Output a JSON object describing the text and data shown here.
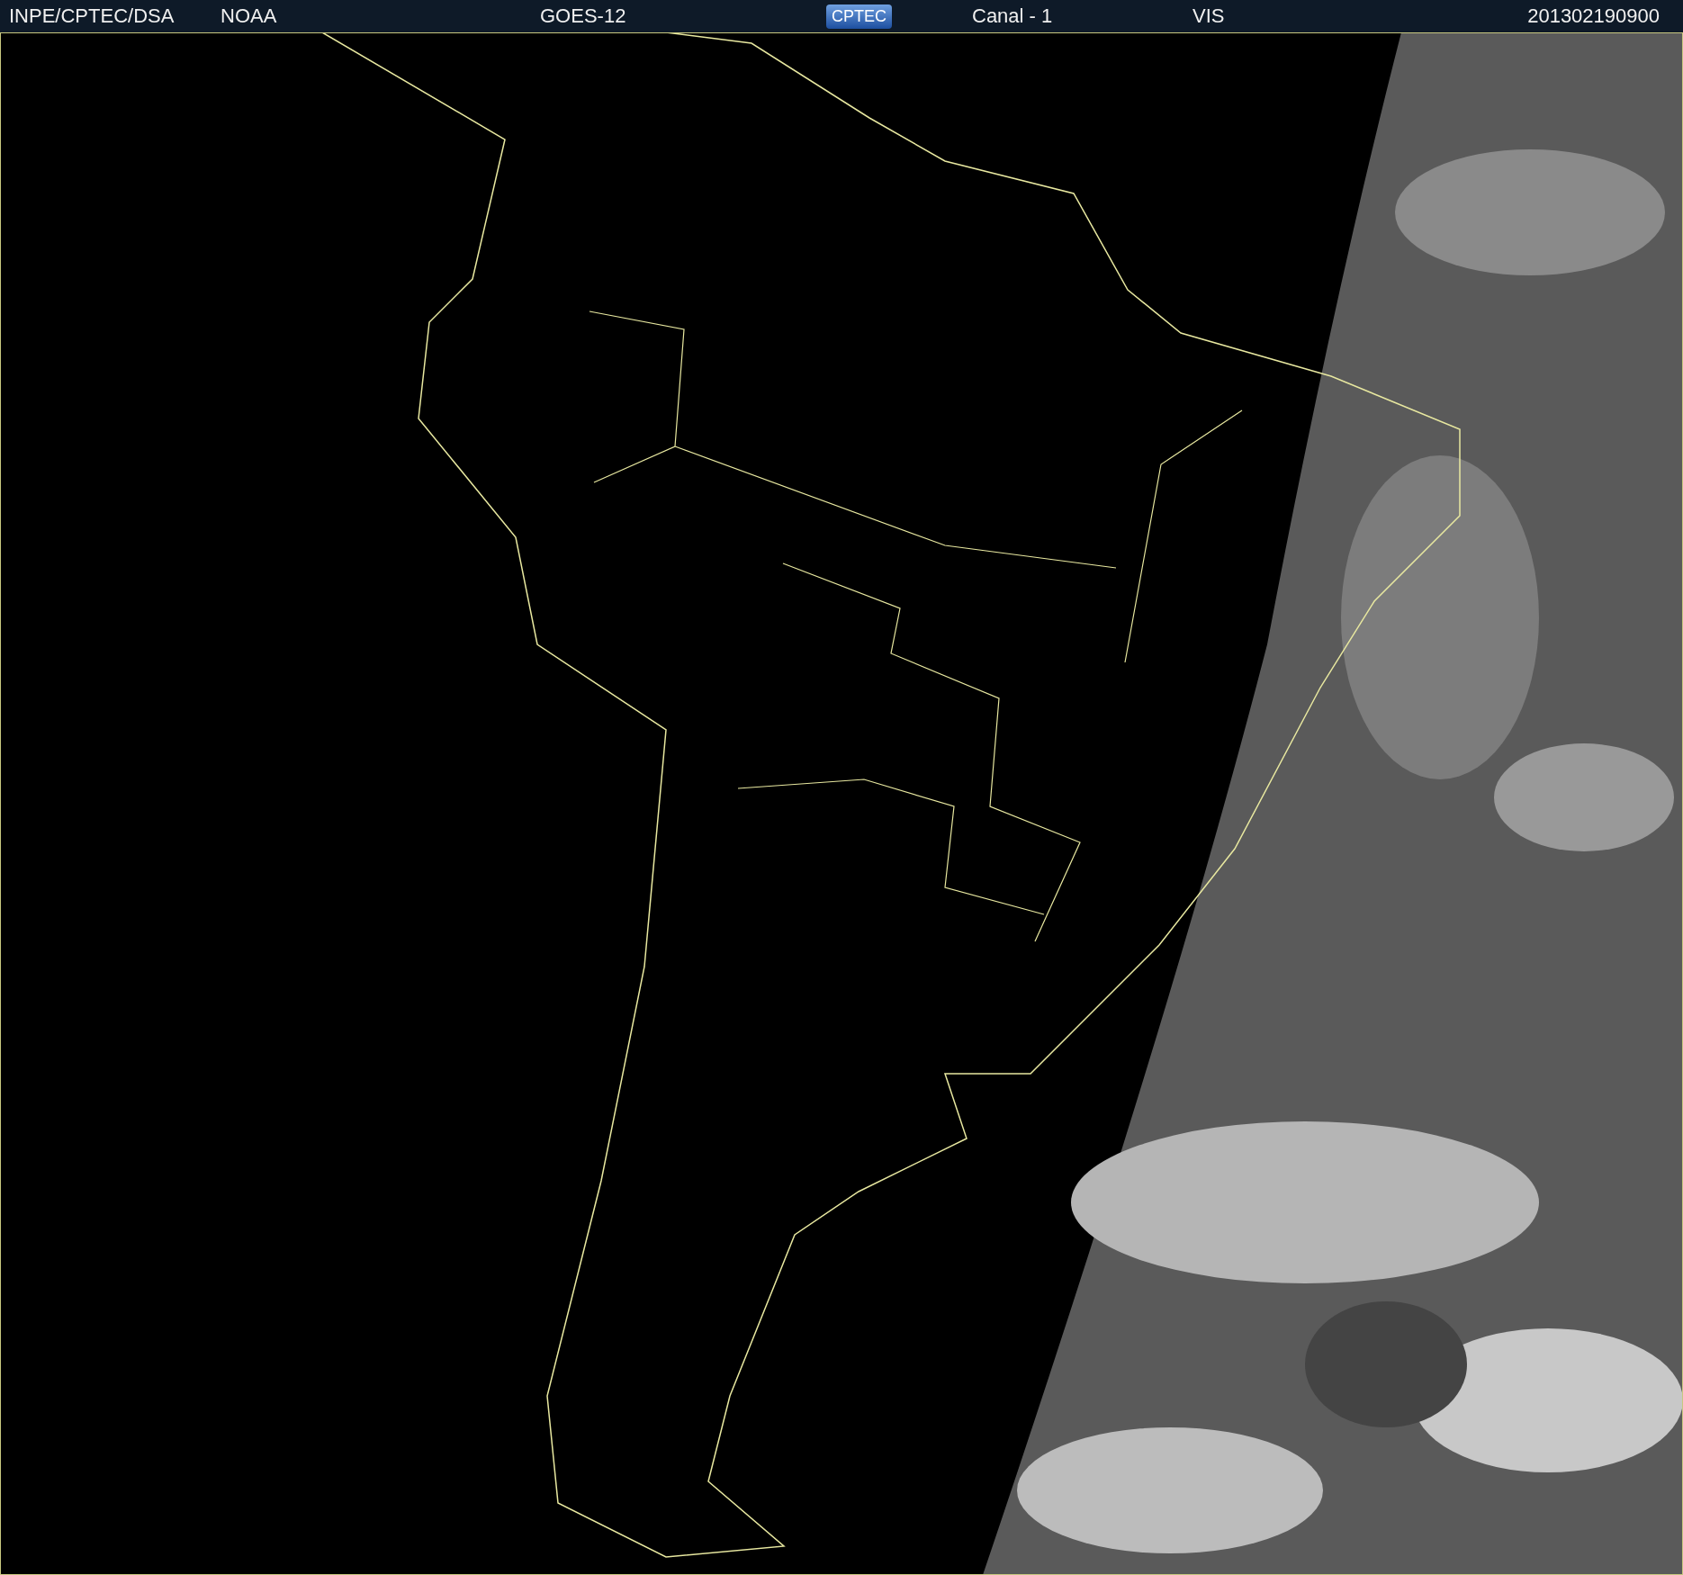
{
  "header": {
    "items": [
      {
        "kind": "text",
        "text": "INPE/CPTEC/DSA"
      },
      {
        "kind": "text",
        "text": "NOAA"
      },
      {
        "kind": "text",
        "text": "GOES-12"
      },
      {
        "kind": "logo",
        "text": "CPTEC"
      },
      {
        "kind": "text",
        "text": "Canal - 1"
      },
      {
        "kind": "text",
        "text": "VIS"
      },
      {
        "kind": "text",
        "text": "201302190900"
      }
    ]
  }
}
